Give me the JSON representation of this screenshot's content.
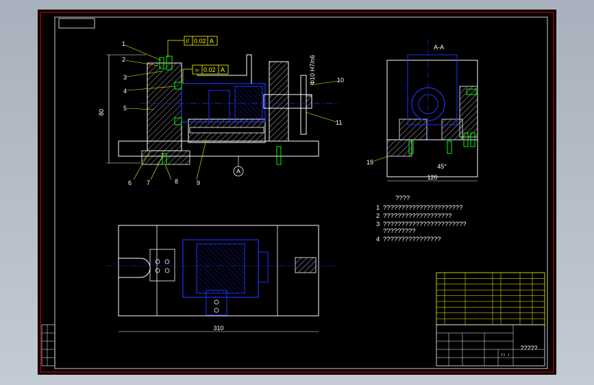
{
  "colors": {
    "outline": "#ffffff",
    "frame": "#ff0000",
    "part_blue": "#1e32ff",
    "leader": "#ffff00",
    "screw": "#00ff00",
    "hatch": "#ffffff"
  },
  "front_view": {
    "tolerance_1": {
      "symbol": "//",
      "value": "0.02",
      "datum": "A"
    },
    "tolerance_2": {
      "symbol": "⌯",
      "value": "0.02",
      "datum": "A"
    },
    "part_numbers": [
      "1",
      "2",
      "3",
      "4",
      "5",
      "6",
      "7",
      "8",
      "9",
      "10",
      "11"
    ],
    "height_dim": "80",
    "datum_label": "A",
    "bore_dim": "Φ10 H7/n6"
  },
  "section_view": {
    "title": "A-A",
    "part_number": "15",
    "width_dim": "120",
    "small_dim": "45°"
  },
  "top_view": {
    "width_dim": "310"
  },
  "notes": {
    "heading": "????",
    "items": [
      {
        "num": "1",
        "text": "??????????????????????"
      },
      {
        "num": "2",
        "text": "???????????????????"
      },
      {
        "num": "3",
        "text": "???????????????????????"
      },
      {
        "num": "",
        "text": "?????????"
      },
      {
        "num": "4",
        "text": "????????????????"
      }
    ]
  },
  "title_block": {
    "drawing_name": "?????",
    "scale_cells": [
      "1:1",
      "1"
    ]
  }
}
